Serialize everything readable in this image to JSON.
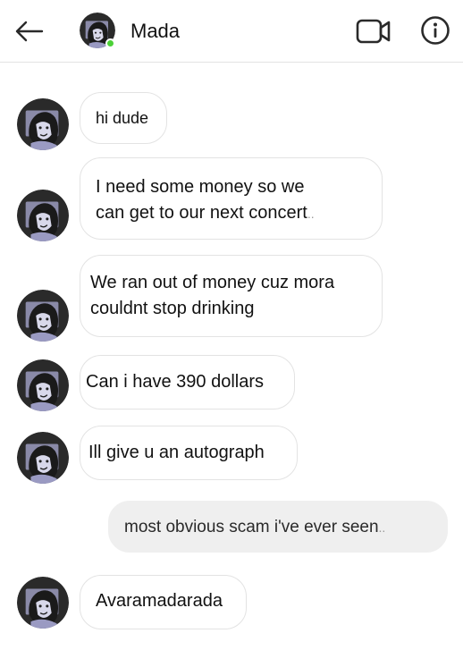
{
  "header": {
    "contact_name": "Mada",
    "online": true
  },
  "icons": {
    "back": "back-arrow-icon",
    "video": "video-call-icon",
    "info": "info-icon"
  },
  "colors": {
    "online": "#4cd137",
    "outgoing_bubble": "#efefef",
    "incoming_border": "#e3e3e3"
  },
  "messages": [
    {
      "direction": "incoming",
      "text": "hi dude"
    },
    {
      "direction": "incoming",
      "line1": "I need some money so we",
      "line2": "can get to our next concert",
      "trail": ".."
    },
    {
      "direction": "incoming",
      "line1": "We ran out of money cuz mora",
      "line2": "couldnt stop drinking"
    },
    {
      "direction": "incoming",
      "text": "Can i have 390 dollars"
    },
    {
      "direction": "incoming",
      "text": "Ill give u an autograph"
    },
    {
      "direction": "outgoing",
      "text": "most obvious scam i've ever seen",
      "trail": ".."
    },
    {
      "direction": "incoming",
      "text": "Avaramadarada"
    }
  ]
}
